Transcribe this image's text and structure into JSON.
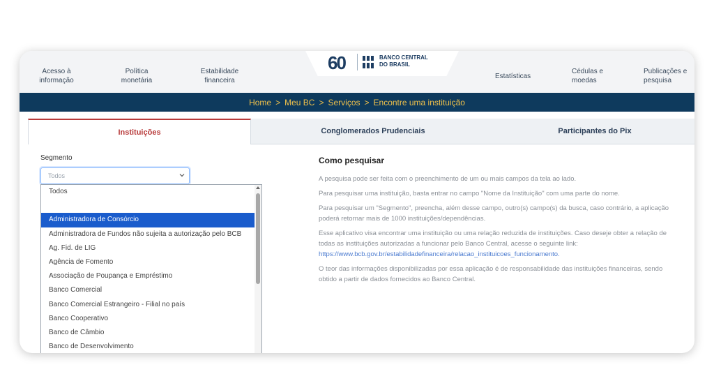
{
  "nav": {
    "items": [
      {
        "label": "Acesso à informação"
      },
      {
        "label": "Política monetária"
      },
      {
        "label": "Estabilidade financeira"
      },
      {
        "label": "Estatísticas"
      },
      {
        "label": "Cédulas e moedas"
      },
      {
        "label": "Publicações e pesquisa"
      }
    ],
    "logo_number": "60",
    "logo_line1": "BANCO CENTRAL",
    "logo_line2": "DO BRASIL"
  },
  "breadcrumb": [
    "Home",
    "Meu BC",
    "Serviços",
    "Encontre uma instituição"
  ],
  "breadcrumb_separator": ">",
  "tabs": [
    {
      "label": "Instituições",
      "active": true
    },
    {
      "label": "Conglomerados Prudenciais",
      "active": false
    },
    {
      "label": "Participantes do Pix",
      "active": false
    }
  ],
  "segment": {
    "label": "Segmento",
    "selected": "Todos",
    "options": [
      "Todos",
      "",
      "Administradora de Consórcio",
      "Administradora de Fundos não sujeita a autorização pelo BCB",
      "Ag. Fid. de LIG",
      "Agência de Fomento",
      "Associação de Poupança e Empréstimo",
      "Banco Comercial",
      "Banco Comercial Estrangeiro - Filial no país",
      "Banco Cooperativo",
      "Banco de Câmbio",
      "Banco de Desenvolvimento"
    ],
    "highlighted": "Administradora de Consórcio"
  },
  "help": {
    "title": "Como pesquisar",
    "p1": "A pesquisa pode ser feita com o preenchimento de um ou mais campos da tela ao lado.",
    "p2": "Para pesquisar uma instituição, basta entrar no campo \"Nome da Instituição\" com uma parte do nome.",
    "p3": "Para pesquisar um \"Segmento\", preencha, além desse campo, outro(s) campo(s) da busca, caso contrário, a aplicação poderá retornar mais de 1000 instituições/dependências.",
    "p4": "Esse aplicativo visa encontrar uma instituição ou uma relação reduzida de instituições. Caso deseje obter a relação de todas as instituições autorizadas a funcionar pelo Banco Central, acesse o seguinte link:",
    "link": "https://www.bcb.gov.br/estabilidadefinanceira/relacao_instituicoes_funcionamento.",
    "p5": "O teor das informações disponibilizadas por essa aplicação é de responsabilidade das instituições financeiras, sendo obtido a partir de dados fornecidos ao Banco Central."
  },
  "colors": {
    "navy": "#0e3a5d",
    "breadcrumb_text": "#f0c14b",
    "active_tab": "#b83b3b",
    "highlight": "#1a5ccc"
  }
}
